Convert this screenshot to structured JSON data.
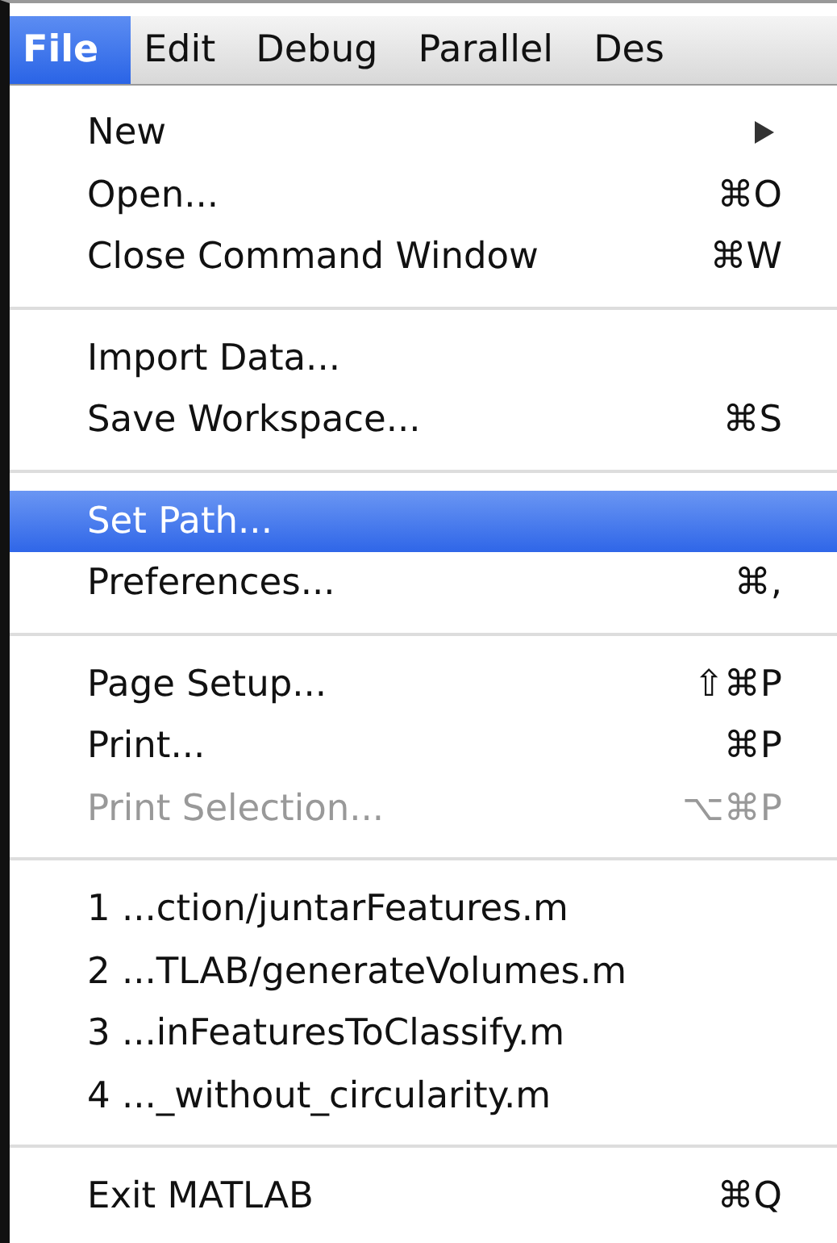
{
  "menubar": [
    {
      "label": "File",
      "selected": true
    },
    {
      "label": "Edit",
      "selected": false
    },
    {
      "label": "Debug",
      "selected": false
    },
    {
      "label": "Parallel",
      "selected": false
    },
    {
      "label": "Des",
      "selected": false
    }
  ],
  "menu": {
    "sections": [
      {
        "items": [
          {
            "label": "New",
            "submenu": true,
            "selected": false,
            "disabled": false
          },
          {
            "label": "Open...",
            "shortcut": "⌘O",
            "selected": false,
            "disabled": false
          },
          {
            "label": "Close Command Window",
            "shortcut": "⌘W",
            "selected": false,
            "disabled": false
          }
        ]
      },
      {
        "items": [
          {
            "label": "Import Data...",
            "selected": false,
            "disabled": false
          },
          {
            "label": "Save Workspace...",
            "shortcut": "⌘S",
            "selected": false,
            "disabled": false
          }
        ]
      },
      {
        "items": [
          {
            "label": "Set Path...",
            "selected": true,
            "disabled": false
          },
          {
            "label": "Preferences...",
            "shortcut": "⌘,",
            "selected": false,
            "disabled": false
          }
        ]
      },
      {
        "items": [
          {
            "label": "Page Setup...",
            "shortcut": "⇧⌘P",
            "selected": false,
            "disabled": false
          },
          {
            "label": "Print...",
            "shortcut": "⌘P",
            "selected": false,
            "disabled": false
          },
          {
            "label": "Print Selection...",
            "shortcut": "⌥⌘P",
            "selected": false,
            "disabled": true
          }
        ]
      },
      {
        "items": [
          {
            "label": "1 ...ction/juntarFeatures.m",
            "selected": false,
            "disabled": false
          },
          {
            "label": "2 ...TLAB/generateVolumes.m",
            "selected": false,
            "disabled": false
          },
          {
            "label": "3 ...inFeaturesToClassify.m",
            "selected": false,
            "disabled": false
          },
          {
            "label": "4 ..._without_circularity.m",
            "selected": false,
            "disabled": false
          }
        ]
      },
      {
        "items": [
          {
            "label": "Exit MATLAB",
            "shortcut": "⌘Q",
            "selected": false,
            "disabled": false
          }
        ]
      }
    ]
  }
}
